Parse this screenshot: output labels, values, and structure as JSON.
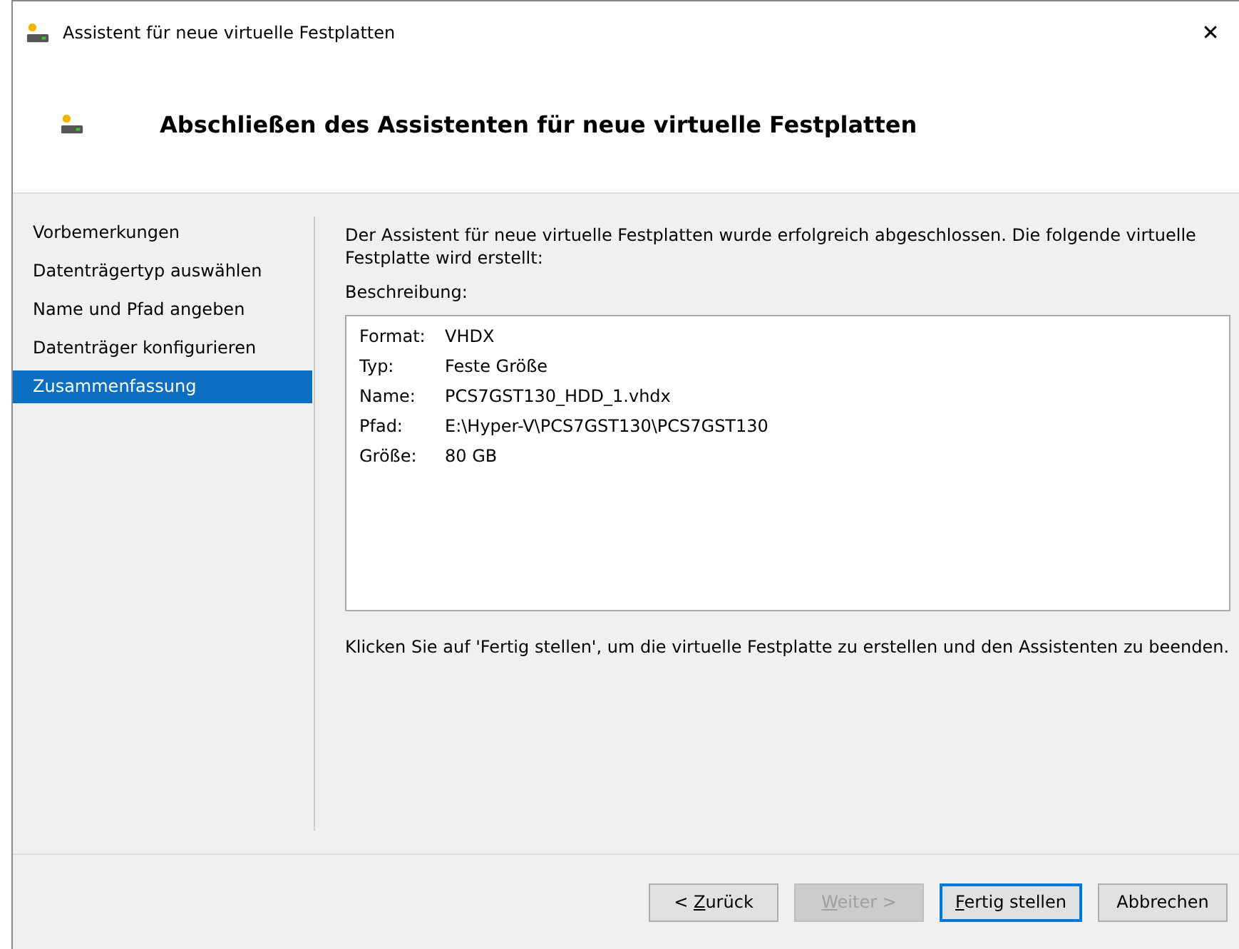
{
  "window": {
    "title": "Assistent für neue virtuelle Festplatten",
    "close": "✕"
  },
  "header": {
    "title": "Abschließen des Assistenten für neue virtuelle Festplatten"
  },
  "sidebar": {
    "items": [
      {
        "label": "Vorbemerkungen",
        "selected": false
      },
      {
        "label": "Datenträgertyp auswählen",
        "selected": false
      },
      {
        "label": "Name und Pfad angeben",
        "selected": false
      },
      {
        "label": "Datenträger konfigurieren",
        "selected": false
      },
      {
        "label": "Zusammenfassung",
        "selected": true
      }
    ]
  },
  "content": {
    "intro": "Der Assistent für neue virtuelle Festplatten wurde erfolgreich abgeschlossen. Die folgende virtuelle Festplatte wird erstellt:",
    "description_label": "Beschreibung:",
    "summary": [
      {
        "key": "Format:",
        "value": "VHDX"
      },
      {
        "key": "Typ:",
        "value": "Feste Größe"
      },
      {
        "key": "Name:",
        "value": "PCS7GST130_HDD_1.vhdx"
      },
      {
        "key": "Pfad:",
        "value": "E:\\Hyper-V\\PCS7GST130\\PCS7GST130"
      },
      {
        "key": "Größe:",
        "value": "80 GB"
      }
    ],
    "outro": "Klicken Sie auf 'Fertig stellen', um die virtuelle Festplatte zu erstellen und den Assistenten zu beenden."
  },
  "buttons": [
    {
      "before": "< ",
      "key": "Z",
      "after": "urück",
      "disabled": false,
      "default": false
    },
    {
      "key": "W",
      "after": "eiter >",
      "disabled": true,
      "default": false
    },
    {
      "key": "F",
      "after": "ertig stellen",
      "disabled": false,
      "default": true
    },
    {
      "after": "Abbrechen",
      "disabled": false,
      "default": false
    }
  ]
}
